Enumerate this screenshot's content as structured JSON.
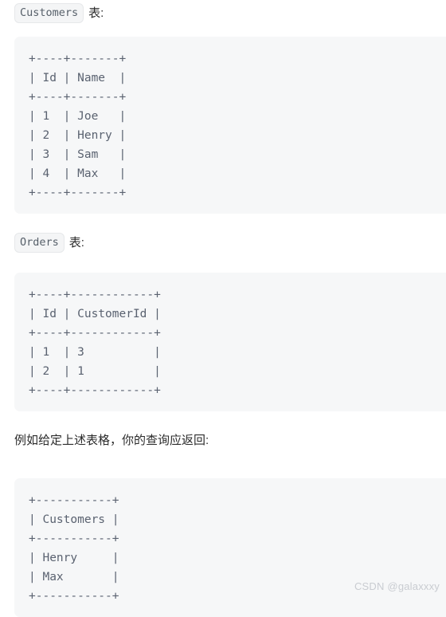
{
  "page": {
    "background_color": "#ffffff",
    "code_block_color": "#f6f7f8",
    "code_text_color": "#5a6270",
    "text_color": "#2b2b2b"
  },
  "sections": {
    "customers": {
      "code_chip": "Customers",
      "suffix_text": "表:",
      "code": "+----+-------+\n| Id | Name  |\n+----+-------+\n| 1  | Joe   |\n| 2  | Henry |\n| 3  | Sam   |\n| 4  | Max   |\n+----+-------+"
    },
    "orders": {
      "code_chip": "Orders",
      "suffix_text": "表:",
      "code": "+----+------------+\n| Id | CustomerId |\n+----+------------+\n| 1  | 3          |\n| 2  | 1          |\n+----+------------+"
    },
    "example": {
      "text": "例如给定上述表格，你的查询应返回:",
      "code": "+-----------+\n| Customers |\n+-----------+\n| Henry     |\n| Max       |\n+-----------+"
    }
  },
  "watermark": {
    "text": "CSDN @galaxxxy"
  }
}
